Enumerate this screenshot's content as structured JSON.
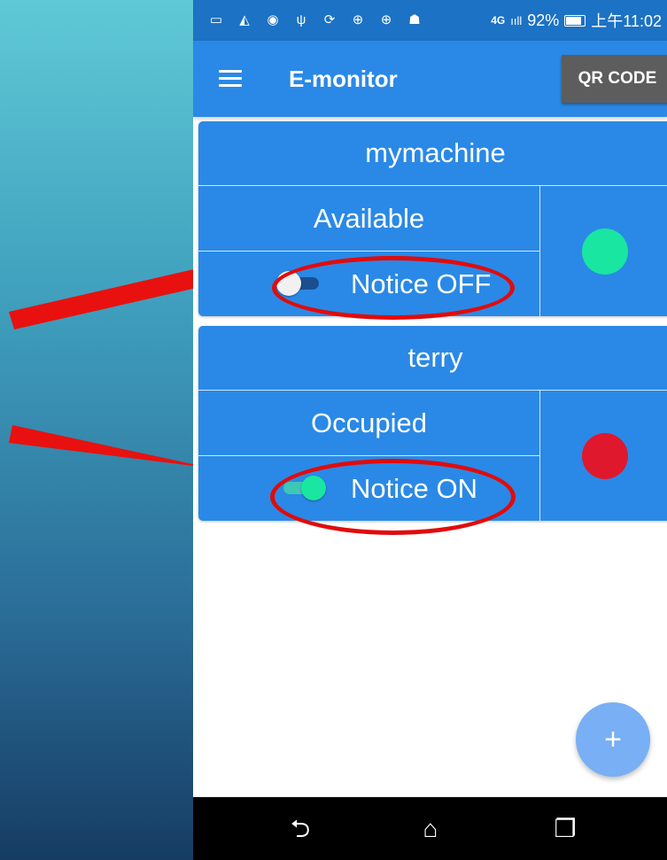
{
  "status_bar": {
    "icons": [
      "screen-icon",
      "navigation-icon",
      "hotspot-icon",
      "usb-icon",
      "sync-icon",
      "download-icon",
      "download-icon",
      "android-icon"
    ],
    "network": "4G",
    "signal": "ııll",
    "battery": "92%",
    "time": "上午11:02"
  },
  "app_bar": {
    "title": "E-monitor",
    "qr_button_label": "QR CODE"
  },
  "machines": [
    {
      "name": "mymachine",
      "status": "Available",
      "notice_label": "Notice OFF",
      "notice_on": false,
      "indicator_color": "#19e6a1"
    },
    {
      "name": "terry",
      "status": "Occupied",
      "notice_label": "Notice ON",
      "notice_on": true,
      "indicator_color": "#e0182d"
    }
  ],
  "fab": {
    "label": "+"
  },
  "nav_bar": {
    "back": "⮌",
    "home": "⌂",
    "recents": "❐"
  },
  "colors": {
    "primary": "#2a89e6",
    "status_bar": "#1c72c4",
    "annotation": "#e10b0b"
  }
}
